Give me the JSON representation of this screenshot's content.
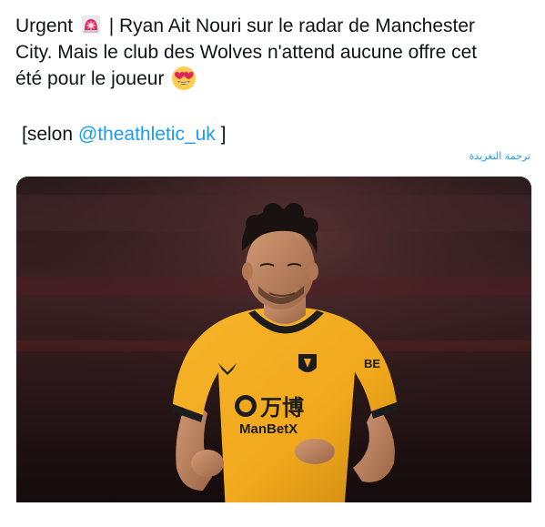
{
  "tweet": {
    "line1_a": "Urgent",
    "line1_b": "| Ryan Ait Nouri sur le radar de Manchester",
    "line2": "City. Mais le club des Wolves n'attend aucune offre cet",
    "line3": "été pour le joueur",
    "source_prefix": "[selon",
    "mention": "@theathletic_uk",
    "source_suffix": "]",
    "translate_label": "ترجمة التغريدة",
    "emojis": [
      "rotating-light-icon",
      "heart-eyes-emoji-icon"
    ]
  },
  "media": {
    "jersey_text_1": "万博",
    "jersey_text_2": "ManBetX",
    "sleeve_text": "BE"
  }
}
